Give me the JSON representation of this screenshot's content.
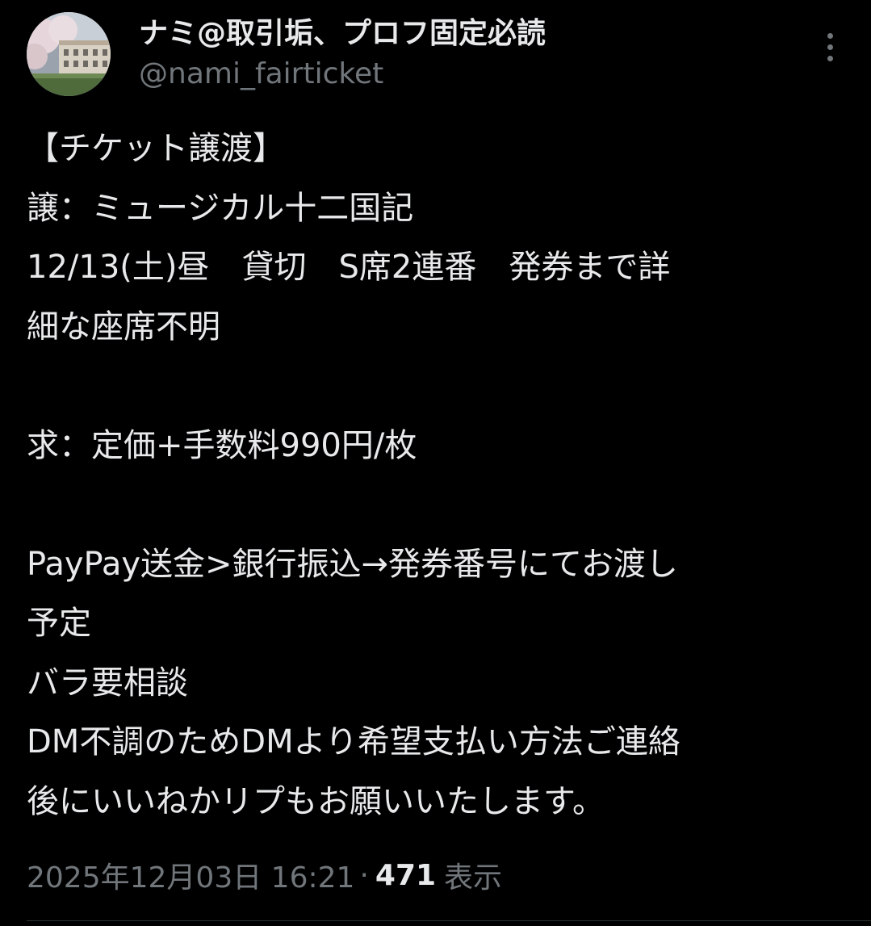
{
  "author": {
    "display_name": "ナミ@取引垢、プロフ固定必読",
    "handle": "@nami_fairticket",
    "avatar_icon": "avatar-photo-building-cherry-blossoms"
  },
  "more_icon": "more-vertical-icon",
  "tweet": {
    "lines": [
      "【チケット譲渡】",
      "譲：ミュージカル十二国記",
      "12/13(土)昼　貸切　S席2連番　発券まで詳",
      "細な座席不明",
      "",
      "求：定価+手数料990円/枚",
      "",
      "PayPay送金>銀行振込→発券番号にてお渡し",
      "予定",
      "バラ要相談",
      "DM不調のためDMより希望支払い方法ご連絡",
      "後にいいねかリプもお願いいたします。"
    ]
  },
  "meta": {
    "timestamp": "2025年12月03日 16:21",
    "separator": "·",
    "views_count": "471",
    "views_label": "表示"
  },
  "colors": {
    "background": "#000000",
    "text_primary": "#e7e9ea",
    "text_secondary": "#71767b",
    "divider": "#2f3336"
  }
}
